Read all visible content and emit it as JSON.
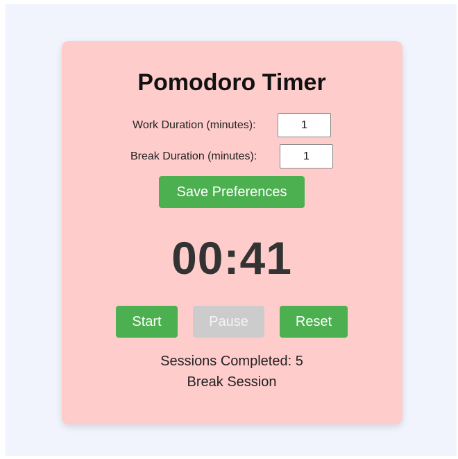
{
  "app": {
    "title": "Pomodoro Timer"
  },
  "preferences": {
    "work_label": "Work Duration (minutes):",
    "work_value": "1",
    "break_label": "Break Duration (minutes):",
    "break_value": "1",
    "save_label": "Save Preferences"
  },
  "timer": {
    "display": "00:41"
  },
  "controls": {
    "start_label": "Start",
    "pause_label": "Pause",
    "reset_label": "Reset"
  },
  "status": {
    "sessions_text": "Sessions Completed: 5",
    "session_type": "Break Session"
  },
  "colors": {
    "page_background": "#f1f4fc",
    "card_background": "#ffcccc",
    "accent_green": "#4caf50",
    "disabled_gray": "#cccccc"
  }
}
